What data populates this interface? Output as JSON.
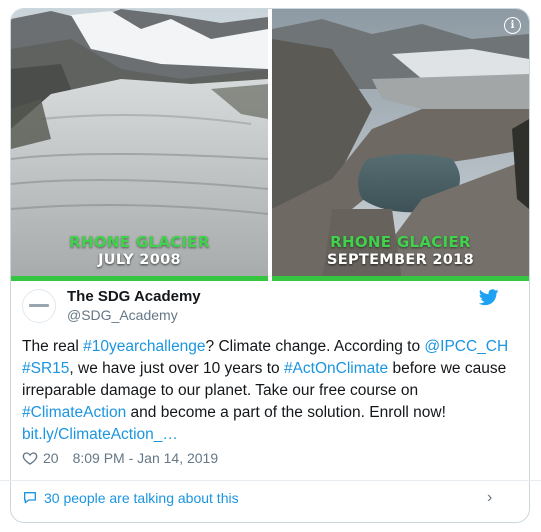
{
  "images": {
    "left": {
      "line1": "RHONE GLACIER",
      "line2": "JULY 2008"
    },
    "right": {
      "line1": "RHONE GLACIER",
      "line2": "SEPTEMBER 2018"
    }
  },
  "author": {
    "name": "The SDG Academy",
    "handle": "@SDG_Academy"
  },
  "tweet": {
    "segments": [
      {
        "text": "The real ",
        "link": false
      },
      {
        "text": "#10yearchallenge",
        "link": true
      },
      {
        "text": "? Climate change. According to ",
        "link": false
      },
      {
        "text": "@IPCC_CH",
        "link": true
      },
      {
        "text": " ",
        "link": false
      },
      {
        "text": "#SR15",
        "link": true
      },
      {
        "text": ", we have just over 10 years to ",
        "link": false
      },
      {
        "text": "#ActOnClimate",
        "link": true
      },
      {
        "text": " before we cause irreparable damage to our planet. Take our free course on ",
        "link": false
      },
      {
        "text": "#ClimateAction",
        "link": true
      },
      {
        "text": " and become a part of the solution. Enroll now! ",
        "link": false
      },
      {
        "text": "bit.ly/ClimateAction_…",
        "link": true
      }
    ]
  },
  "meta": {
    "likes": "20",
    "timestamp": "8:09 PM - Jan 14, 2019"
  },
  "footer": {
    "talking": "30 people are talking about this"
  },
  "colors": {
    "link": "#1b95e0",
    "caption_green": "#3fd24a",
    "twitter_blue": "#1da1f2"
  }
}
